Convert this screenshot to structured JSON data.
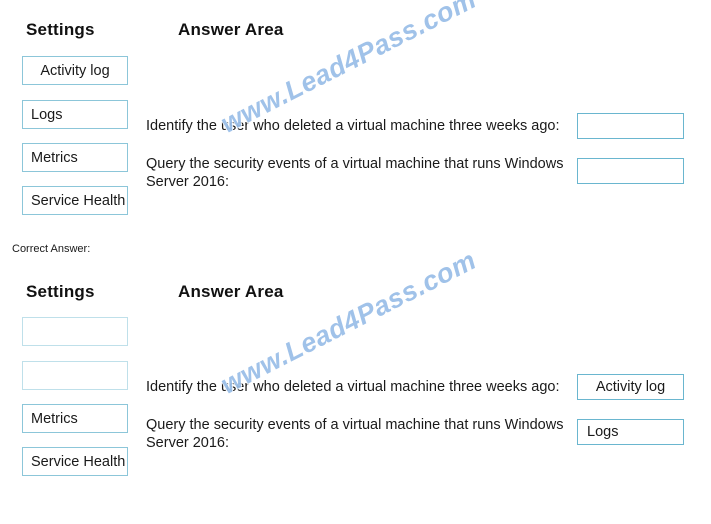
{
  "page": {
    "correct_answer_label": "Correct Answer:",
    "watermark_text": "www.Lead4Pass.com",
    "watermark_color": "#9bbfe8",
    "box_border_color": "#6ab6cf",
    "empty_box_border_color": "#bfe0ea"
  },
  "question": {
    "headers": {
      "settings": "Settings",
      "answer_area": "Answer Area"
    },
    "settings_options": [
      {
        "label": "Activity log"
      },
      {
        "label": "Logs"
      },
      {
        "label": "Metrics"
      },
      {
        "label": "Service Health"
      }
    ],
    "prompts": [
      {
        "text": "Identify the user who deleted a virtual machine three weeks ago:"
      },
      {
        "text": "Query the security events of a virtual machine that runs Windows Server 2016:"
      }
    ],
    "answers": [
      {
        "value": ""
      },
      {
        "value": ""
      }
    ]
  },
  "correct_answer": {
    "headers": {
      "settings": "Settings",
      "answer_area": "Answer Area"
    },
    "settings_options": [
      {
        "label": ""
      },
      {
        "label": ""
      },
      {
        "label": "Metrics"
      },
      {
        "label": "Service Health"
      }
    ],
    "prompts": [
      {
        "text": "Identify the user who deleted a virtual machine three weeks ago:"
      },
      {
        "text": "Query the security events of a virtual machine that runs Windows Server 2016:"
      }
    ],
    "answers": [
      {
        "value": "Activity log"
      },
      {
        "value": "Logs"
      }
    ]
  }
}
